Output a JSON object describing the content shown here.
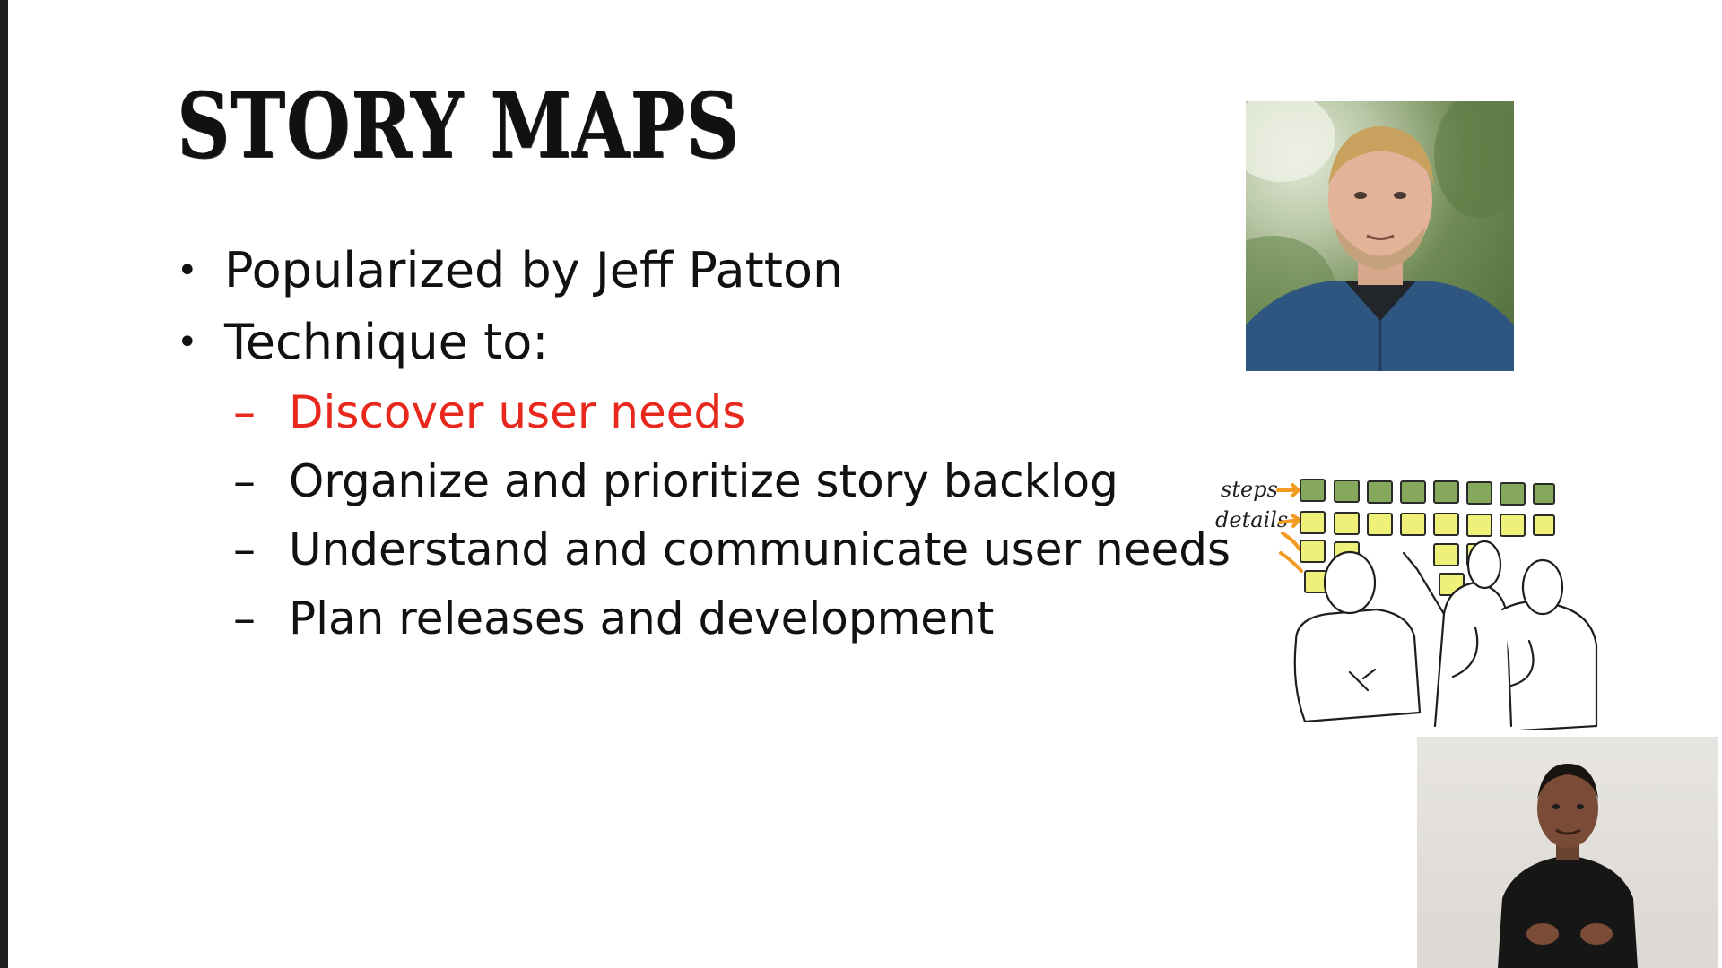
{
  "slide": {
    "title": "STORY MAPS",
    "bullets": [
      {
        "marker": "•",
        "text": "Popularized by Jeff Patton"
      },
      {
        "marker": "•",
        "text": "Technique to:"
      }
    ],
    "subitems": [
      {
        "marker": "–",
        "text": "Discover user needs",
        "color": "#e8281c"
      },
      {
        "marker": "–",
        "text": "Organize and prioritize story backlog"
      },
      {
        "marker": "–",
        "text": "Understand and communicate user needs"
      },
      {
        "marker": "–",
        "text": "Plan releases and development"
      }
    ]
  },
  "sketch": {
    "label_steps": "steps",
    "label_details": "details"
  },
  "colors": {
    "highlight": "#e8281c",
    "step_note": "#86a85c",
    "detail_note": "#eef07a",
    "arrow": "#f39a21"
  }
}
